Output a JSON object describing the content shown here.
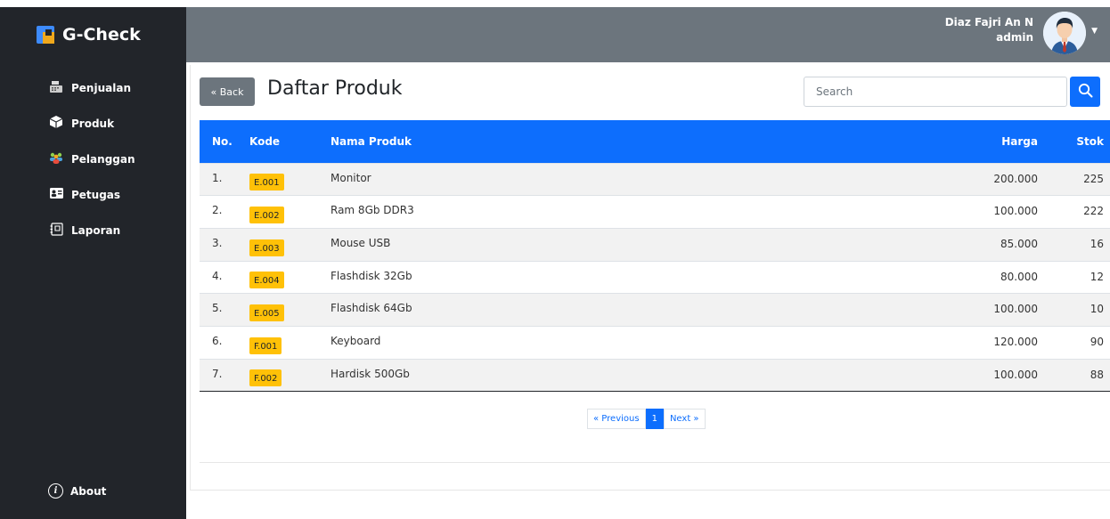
{
  "app": {
    "name": "G-Check"
  },
  "sidebar": {
    "items": [
      {
        "label": "Penjualan",
        "icon": "cash-register-icon"
      },
      {
        "label": "Produk",
        "icon": "box-icon"
      },
      {
        "label": "Pelanggan",
        "icon": "users-icon"
      },
      {
        "label": "Petugas",
        "icon": "id-card-icon"
      },
      {
        "label": "Laporan",
        "icon": "report-icon"
      }
    ],
    "about": "About"
  },
  "topbar": {
    "user_name": "Diaz Fajri An N",
    "user_role": "admin"
  },
  "page": {
    "back_label": "« Back",
    "title": "Daftar Produk",
    "search_placeholder": "Search"
  },
  "table": {
    "headers": {
      "no": "No.",
      "kode": "Kode",
      "nama": "Nama Produk",
      "harga": "Harga",
      "stok": "Stok"
    },
    "rows": [
      {
        "no": "1.",
        "kode": "E.001",
        "nama": "Monitor",
        "harga": "200.000",
        "stok": "225"
      },
      {
        "no": "2.",
        "kode": "E.002",
        "nama": "Ram 8Gb DDR3",
        "harga": "100.000",
        "stok": "222"
      },
      {
        "no": "3.",
        "kode": "E.003",
        "nama": "Mouse USB",
        "harga": "85.000",
        "stok": "16"
      },
      {
        "no": "4.",
        "kode": "E.004",
        "nama": "Flashdisk 32Gb",
        "harga": "80.000",
        "stok": "12"
      },
      {
        "no": "5.",
        "kode": "E.005",
        "nama": "Flashdisk 64Gb",
        "harga": "100.000",
        "stok": "10"
      },
      {
        "no": "6.",
        "kode": "F.001",
        "nama": "Keyboard",
        "harga": "120.000",
        "stok": "90"
      },
      {
        "no": "7.",
        "kode": "F.002",
        "nama": "Hardisk 500Gb",
        "harga": "100.000",
        "stok": "88"
      }
    ]
  },
  "pagination": {
    "previous": "« Previous",
    "current": "1",
    "next": "Next »"
  },
  "colors": {
    "primary": "#0d6efd",
    "badge": "#ffc107",
    "sidebar": "#22252a",
    "topbar": "#6c757d"
  }
}
